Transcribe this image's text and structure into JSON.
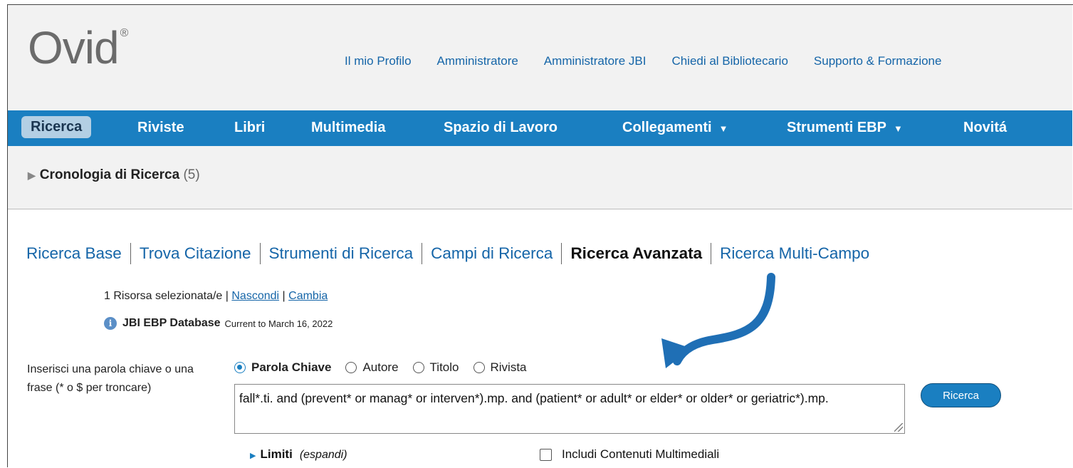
{
  "logo": {
    "text": "Ovid",
    "mark": "®"
  },
  "top_links": [
    "Il mio Profilo",
    "Amministratore",
    "Amministratore JBI",
    "Chiedi al Bibliotecario",
    "Supporto & Formazione"
  ],
  "nav": {
    "ricerca": "Ricerca",
    "riviste": "Riviste",
    "libri": "Libri",
    "multimedia": "Multimedia",
    "spazio": "Spazio di Lavoro",
    "collegamenti": "Collegamenti",
    "strumenti_ebp": "Strumenti EBP",
    "novita": "Novitá",
    "dropdown_caret": "▼"
  },
  "history": {
    "label": "Cronologia di Ricerca",
    "count": "(5)"
  },
  "tabs": [
    "Ricerca Base",
    "Trova Citazione",
    "Strumenti di Ricerca",
    "Campi di Ricerca",
    "Ricerca Avanzata",
    "Ricerca Multi-Campo"
  ],
  "active_tab": "Ricerca Avanzata",
  "resources": {
    "text": "1 Risorsa selezionata/e |",
    "hide": "Nascondi",
    "pipe": "|",
    "change": "Cambia"
  },
  "database": {
    "name": "JBI EBP Database",
    "currency": "Current to March 16, 2022",
    "info_icon": "info-icon"
  },
  "prompt": "Inserisci una parola chiave o una frase (* o $ per troncare)",
  "search_types": [
    {
      "label": "Parola Chiave",
      "selected": true
    },
    {
      "label": "Autore",
      "selected": false
    },
    {
      "label": "Titolo",
      "selected": false
    },
    {
      "label": "Rivista",
      "selected": false
    }
  ],
  "query": "fall*.ti. and (prevent* or manag* or interven*).mp. and (patient* or adult* or elder* or older* or geriatric*).mp.",
  "search_button": "Ricerca",
  "limits": {
    "label": "Limiti",
    "expand": "(espandi)"
  },
  "multimedia_option": {
    "label": "Includi Contenuti Multimediali",
    "checked": false
  },
  "colors": {
    "nav_blue": "#1a7fc1",
    "link_blue": "#1565a8",
    "active_tab_bg": "#b3cfe4",
    "header_bg": "#f2f2f2"
  }
}
